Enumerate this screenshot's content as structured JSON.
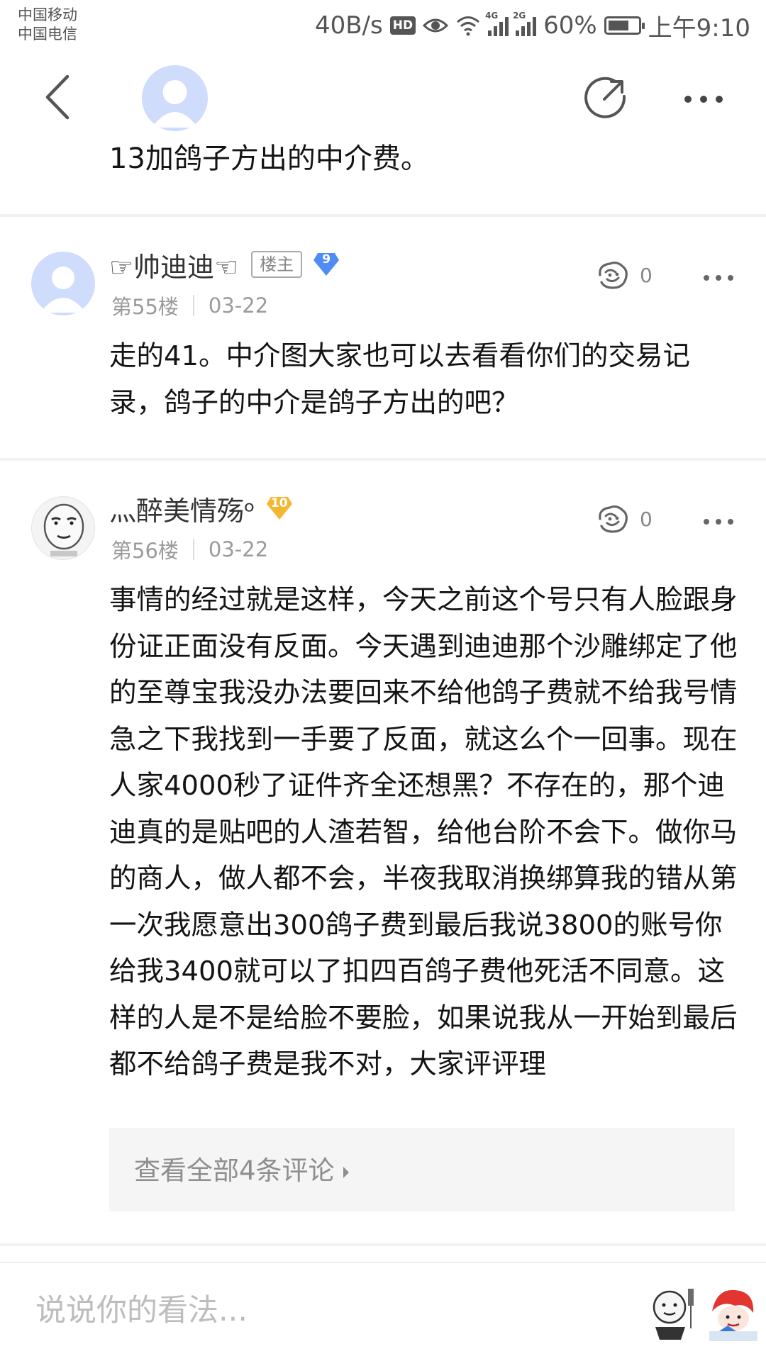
{
  "status_bar": {
    "carrier_1": "中国移动",
    "carrier_2": "中国电信",
    "net_speed": "40B/s",
    "hd": "HD",
    "sim1_type": "4G",
    "sim2_type": "2G",
    "battery": "60%",
    "time": "上午9:10"
  },
  "previous_post": {
    "text_tail": "13加鸽子方出的中介费。"
  },
  "posts": [
    {
      "username": "☞帅迪迪☜",
      "owner_badge": "楼主",
      "level": "9",
      "floor": "第55楼",
      "date": "03-22",
      "likes": "0",
      "content": "走的41。中介图大家也可以去看看你们的交易记录，鸽子的中介是鸽子方出的吧？"
    },
    {
      "username": "灬醉美情殇ᵒ",
      "level": "10",
      "floor": "第56楼",
      "date": "03-22",
      "likes": "0",
      "content": "事情的经过就是这样，今天之前这个号只有人脸跟身份证正面没有反面。今天遇到迪迪那个沙雕绑定了他的至尊宝我没办法要回来不给他鸽子费就不给我号情急之下我找到一手要了反面，就这么个一回事。现在人家4000秒了证件齐全还想黑？不存在的，那个迪迪真的是贴吧的人渣若智，给他台阶不会下。做你马的商人，做人都不会，半夜我取消换绑算我的错从第一次我愿意出300鸽子费到最后我说3800的账号你给我3400就可以了扣四百鸽子费他死活不同意。这样的人是不是给脸不要脸，如果说我从一开始到最后都不给鸽子费是我不对，大家评评理",
      "view_replies": "查看全部4条评论"
    }
  ],
  "bottom_bar": {
    "placeholder": "说说你的看法..."
  },
  "colors": {
    "level_9_badge": "#4f8cf5",
    "level_10_badge": "#f5b731",
    "default_avatar": "#cfdcfb"
  },
  "icons": [
    "back-icon",
    "share-icon",
    "more-icon",
    "like-icon",
    "sticker-icon"
  ]
}
